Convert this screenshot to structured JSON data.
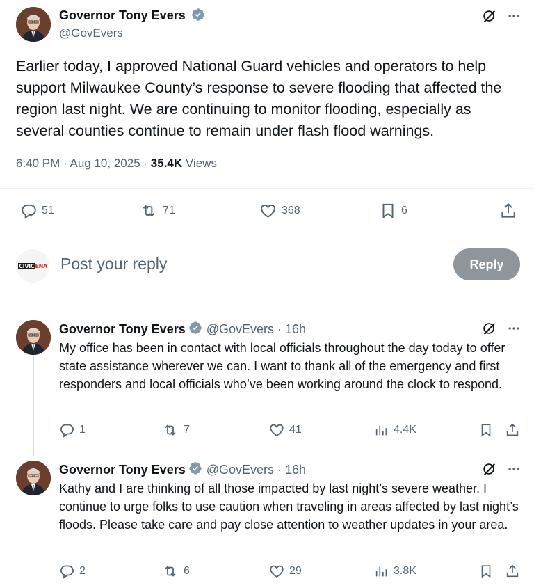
{
  "main_tweet": {
    "author_name": "Governor Tony Evers",
    "handle": "@GovEvers",
    "text": "Earlier today, I approved National Guard vehicles and operators to help support Milwaukee County’s response to severe flooding that affected the region last night. We are continuing to monitor flooding, especially as several counties continue to remain under flash flood warnings.",
    "time": "6:40 PM",
    "date": "Aug 10, 2025",
    "views_count": "35.4K",
    "views_label": "Views",
    "replies": "51",
    "reposts": "71",
    "likes": "368",
    "bookmarks": "6"
  },
  "reply_composer": {
    "placeholder": "Post your reply",
    "button_label": "Reply",
    "avatar_text": "CIVICENA"
  },
  "replies": [
    {
      "author_name": "Governor Tony Evers",
      "handle": "@GovEvers · 16h",
      "text": "My office has been in contact with local officials throughout the day today to offer state assistance wherever we can. I want to thank all of the emergency and first responders and local officials who’ve been working around the clock to respond.",
      "replies": "1",
      "reposts": "7",
      "likes": "41",
      "views": "4.4K"
    },
    {
      "author_name": "Governor Tony Evers",
      "handle": "@GovEvers · 16h",
      "text": "Kathy and I are thinking of all those impacted by last night’s severe weather. I continue to urge folks to use caution when traveling in areas affected by last night’s floods. Please take care and pay close attention to weather updates in your area.",
      "replies": "2",
      "reposts": "6",
      "likes": "29",
      "views": "3.8K"
    }
  ],
  "colors": {
    "text": "#0f1419",
    "secondary": "#536471",
    "verified": "#829aab",
    "reply_button": "#8e969c"
  },
  "icons": [
    "grok-icon",
    "more-icon",
    "reply-icon",
    "repost-icon",
    "like-icon",
    "bookmark-icon",
    "share-icon",
    "views-icon",
    "verified-icon"
  ]
}
